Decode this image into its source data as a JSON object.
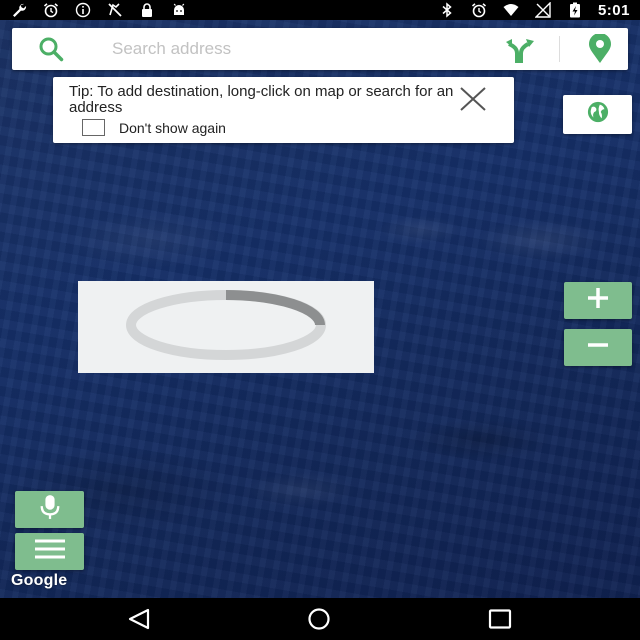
{
  "status_bar": {
    "left_icons": [
      "wrench-icon",
      "alarm-icon",
      "info-icon",
      "no-gps-icon",
      "lock-icon",
      "android-icon"
    ],
    "right_icons": [
      "bluetooth-icon",
      "alarm-icon",
      "wifi-icon",
      "signal-icon",
      "battery-charging-icon"
    ],
    "time": "5:01"
  },
  "search": {
    "placeholder": "Search address",
    "value": "",
    "icons": {
      "search": "search-icon",
      "route": "route-icon",
      "pin": "location-pin-icon"
    }
  },
  "tip": {
    "text": "Tip: To add destination, long-click on map or search for an address",
    "checkbox_label": "Don't show again",
    "checkbox_checked": false
  },
  "map": {
    "globe_icon": "globe-icon",
    "zoom_in_icon": "plus-icon",
    "zoom_out_icon": "minus-icon",
    "mic_icon": "microphone-icon",
    "menu_icon": "hamburger-menu-icon",
    "loading_icon": "loading-spinner-icon",
    "attribution": "Google"
  },
  "nav_bar": {
    "icons": [
      "back-icon",
      "home-icon",
      "recents-icon"
    ]
  },
  "colors": {
    "accent": "#4caf66",
    "button_green": "#7fbd8e",
    "map_ocean": "#16306a",
    "status_bar": "#000000"
  }
}
